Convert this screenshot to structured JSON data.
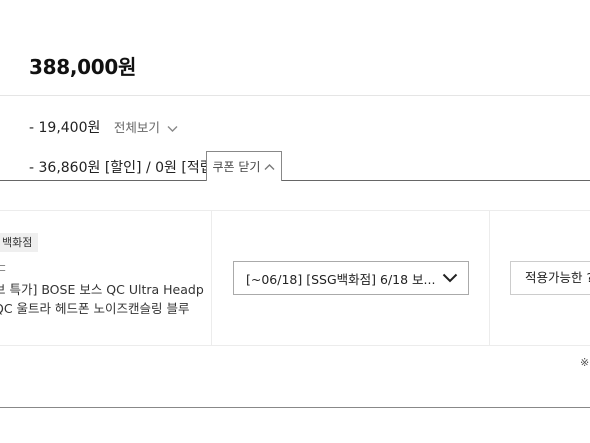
{
  "price": {
    "total": "388,000원"
  },
  "discount": {
    "amount": "- 19,400원",
    "view_all_label": "전체보기"
  },
  "coupon": {
    "summary": "- 36,860원 [할인] / 0원 [적립]",
    "close_tab_label": "쿠폰 닫기"
  },
  "product": {
    "store_badge": "백화점",
    "tiny_label": "ㄷ",
    "title_line1": "브 특가] BOSE 보스 QC Ultra Headp",
    "title_line2": "QC 울트라 헤드폰 노이즈캔슬링 블루"
  },
  "coupon_select": {
    "selected": "[~06/18] [SSG백화점] 6/18 보..."
  },
  "apply_button": {
    "label": "적용가능한 ?"
  },
  "footnote": {
    "mark": "※"
  }
}
